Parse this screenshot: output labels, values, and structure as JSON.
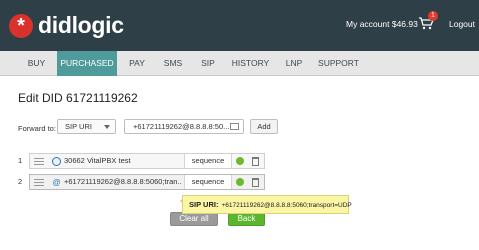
{
  "header": {
    "brand": "didlogic",
    "logo_mark": "*",
    "account_label": "My account",
    "balance": "$46.93",
    "cart_count": "1",
    "logout_label": "Logout",
    "colors": {
      "header_bg": "#2e3f47",
      "brand_red": "#d9322c"
    }
  },
  "nav": {
    "items": [
      {
        "label": "BUY"
      },
      {
        "label": "PURCHASED"
      },
      {
        "label": "PAY"
      },
      {
        "label": "SMS"
      },
      {
        "label": "SIP"
      },
      {
        "label": "HISTORY"
      },
      {
        "label": "LNP"
      },
      {
        "label": "SUPPORT"
      }
    ],
    "active": "PURCHASED",
    "active_color": "#4f9a9a"
  },
  "page": {
    "title": "Edit DID 61721119262"
  },
  "forward": {
    "label": "Forward to:",
    "type_value": "SIP URI",
    "uri_value": "+61721119262@8.8.8.8:50...",
    "add_label": "Add"
  },
  "destinations": [
    {
      "index": "1",
      "icon": "globe-icon",
      "value": "30662 VitalPBX test",
      "mode": "sequence",
      "status": "active"
    },
    {
      "index": "2",
      "icon": "at-icon",
      "value": "+61721119262@8.8.8.8:5060;tran...",
      "mode": "sequence",
      "status": "active"
    }
  ],
  "actions": {
    "clear_label": "Clear all",
    "back_label": "Back"
  },
  "tooltip": {
    "label": "SIP URI:",
    "value": "+61721119262@8.8.8.8:5060;transport=UDP"
  }
}
